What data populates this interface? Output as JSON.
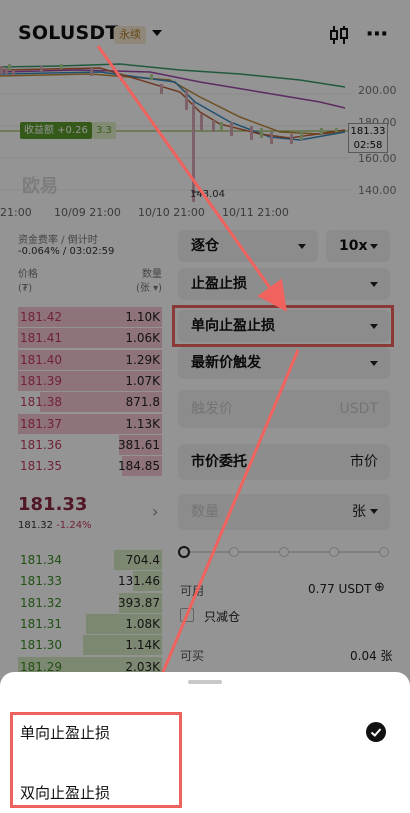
{
  "header": {
    "symbol": "SOLUSDT",
    "badge": "永续"
  },
  "chart": {
    "price_labels": [
      "200.00",
      "180.00",
      "160.00",
      "140.00"
    ],
    "current_price": "181.33",
    "countdown": "02:58",
    "pnl_label": "收益额 +0.26",
    "pnl_value": "3.3",
    "low_label": "143.04",
    "watermark": "欧易",
    "dates": [
      "21:00",
      "10/09 21:00",
      "10/10 21:00",
      "10/11 21:00"
    ]
  },
  "funding": {
    "label": "资金费率 / 倒计时",
    "value": "-0.064% / 03:02:59"
  },
  "orderbook": {
    "price_header": "价格",
    "price_unit": "(₮)",
    "qty_header": "数量",
    "qty_unit": "(张 ▾)",
    "asks": [
      {
        "price": "181.42",
        "qty": "1.10K",
        "depth": 1.0
      },
      {
        "price": "181.41",
        "qty": "1.06K",
        "depth": 1.0
      },
      {
        "price": "181.40",
        "qty": "1.29K",
        "depth": 1.0
      },
      {
        "price": "181.39",
        "qty": "1.07K",
        "depth": 1.0
      },
      {
        "price": "181.38",
        "qty": "871.8",
        "depth": 0.85
      },
      {
        "price": "181.37",
        "qty": "1.13K",
        "depth": 1.0
      },
      {
        "price": "181.36",
        "qty": "381.61",
        "depth": 0.3
      },
      {
        "price": "181.35",
        "qty": "184.85",
        "depth": 0.28
      }
    ],
    "mid_price": "181.33",
    "mid_index": "181.32",
    "mid_change": "-1.24%",
    "bids": [
      {
        "price": "181.34",
        "qty": "704.4",
        "depth": 0.33
      },
      {
        "price": "181.33",
        "qty": "131.46",
        "depth": 0.2
      },
      {
        "price": "181.32",
        "qty": "393.87",
        "depth": 0.3
      },
      {
        "price": "181.31",
        "qty": "1.08K",
        "depth": 0.53
      },
      {
        "price": "181.30",
        "qty": "1.14K",
        "depth": 0.55
      },
      {
        "price": "181.29",
        "qty": "2.03K",
        "depth": 1.0
      }
    ]
  },
  "form": {
    "margin_mode": "逐仓",
    "leverage": "10x",
    "order_type": "止盈止损",
    "tpsl_mode": "单向止盈止损",
    "trigger_type": "最新价触发",
    "trigger_price_placeholder": "触发价",
    "trigger_unit": "USDT",
    "exec_type": "市价委托",
    "exec_price": "市价",
    "qty_placeholder": "数量",
    "qty_unit": "张",
    "slider_value": 0,
    "available_label": "可用",
    "available_value": "0.77 USDT",
    "reduce_only": "只减仓",
    "can_buy_label": "可买",
    "can_buy_value": "0.04 张"
  },
  "sheet": {
    "options": [
      "单向止盈止损",
      "双向止盈止损"
    ],
    "selected": 0
  },
  "colors": {
    "ask": "#c23b5f",
    "bid": "#3a8a22",
    "highlight": "#f0625e"
  }
}
